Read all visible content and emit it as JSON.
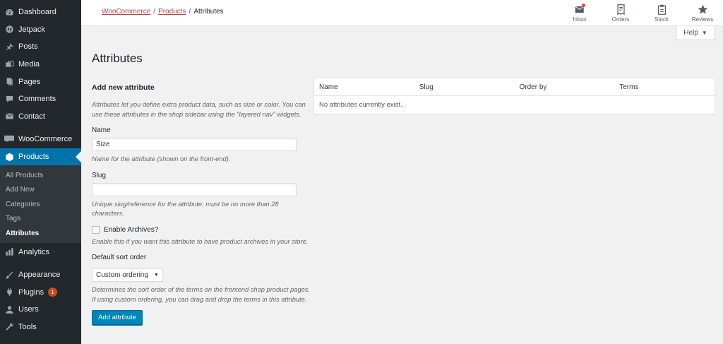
{
  "sidebar": {
    "items": [
      {
        "label": "Dashboard",
        "icon": "dashboard-icon"
      },
      {
        "label": "Jetpack",
        "icon": "jetpack-icon"
      },
      {
        "label": "Posts",
        "icon": "pin-icon"
      },
      {
        "label": "Media",
        "icon": "media-icon"
      },
      {
        "label": "Pages",
        "icon": "pages-icon"
      },
      {
        "label": "Comments",
        "icon": "comments-icon"
      },
      {
        "label": "Contact",
        "icon": "mail-icon"
      },
      {
        "label": "WooCommerce",
        "icon": "woocommerce-icon"
      },
      {
        "label": "Products",
        "icon": "products-icon"
      },
      {
        "label": "Analytics",
        "icon": "analytics-icon"
      },
      {
        "label": "Appearance",
        "icon": "brush-icon"
      },
      {
        "label": "Plugins",
        "icon": "plugin-icon",
        "badge": "1"
      },
      {
        "label": "Users",
        "icon": "users-icon"
      },
      {
        "label": "Tools",
        "icon": "wrench-icon"
      }
    ],
    "submenu": [
      "All Products",
      "Add New",
      "Categories",
      "Tags",
      "Attributes"
    ]
  },
  "breadcrumb": {
    "woo": "WooCommerce",
    "products": "Products",
    "current": "Attributes",
    "sep": "/"
  },
  "toolbar": [
    {
      "label": "Inbox",
      "icon": "inbox-icon"
    },
    {
      "label": "Orders",
      "icon": "orders-icon"
    },
    {
      "label": "Stock",
      "icon": "stock-icon"
    },
    {
      "label": "Reviews",
      "icon": "star-icon"
    }
  ],
  "help": {
    "label": "Help"
  },
  "page": {
    "title": "Attributes"
  },
  "form": {
    "heading": "Add new attribute",
    "intro": "Attributes let you define extra product data, such as size or color. You can use these attributes in the shop sidebar using the \"layered nav\" widgets.",
    "name_label": "Name",
    "name_value": "Size",
    "name_desc": "Name for the attribute (shown on the front-end).",
    "slug_label": "Slug",
    "slug_value": "",
    "slug_desc": "Unique slug/reference for the attribute; must be no more than 28 characters.",
    "archives_label": "Enable Archives?",
    "archives_desc": "Enable this if you want this attribute to have product archives in your store.",
    "sort_label": "Default sort order",
    "sort_value": "Custom ordering",
    "sort_desc": "Determines the sort order of the terms on the frontend shop product pages. If using custom ordering, you can drag and drop the terms in this attribute.",
    "submit_label": "Add attribute"
  },
  "table": {
    "columns": [
      "Name",
      "Slug",
      "Order by",
      "Terms"
    ],
    "empty": "No attributes currently exist."
  },
  "colors": {
    "accent": "#0073aa",
    "button": "#0085ba",
    "sidebar": "#23282d",
    "badge": "#ca4a1f",
    "link": "#b5474a"
  }
}
